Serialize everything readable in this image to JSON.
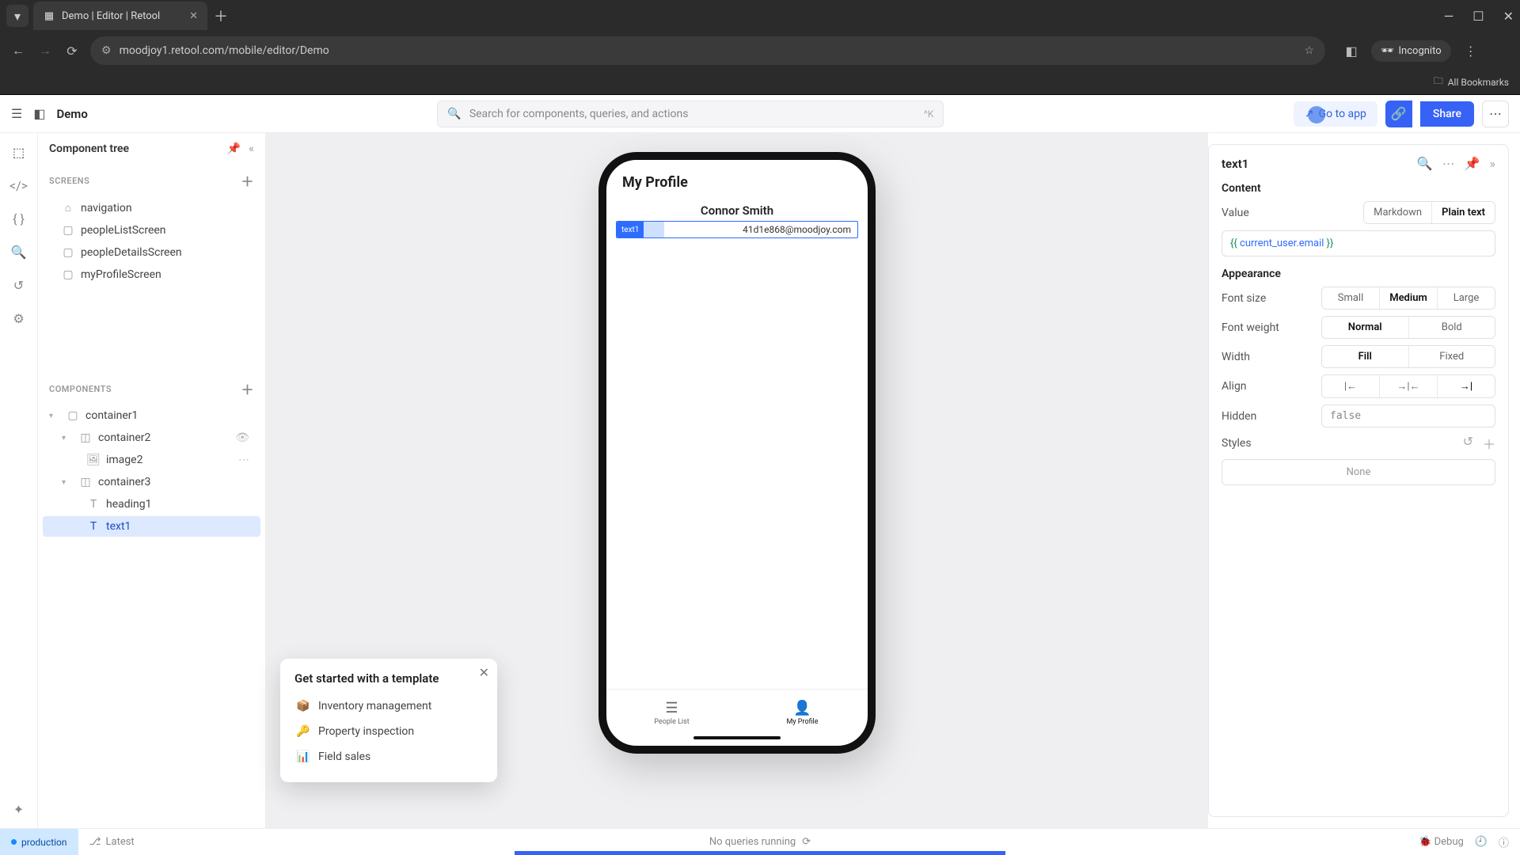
{
  "browser": {
    "tab_title": "Demo | Editor | Retool",
    "url": "moodjoy1.retool.com/mobile/editor/Demo",
    "incognito": "Incognito",
    "bookmarks": "All Bookmarks"
  },
  "header": {
    "app_name": "Demo",
    "search_placeholder": "Search for components, queries, and actions",
    "search_kbd": "^K",
    "go_to_app": "Go to app",
    "share": "Share"
  },
  "sidebar": {
    "title": "Component tree",
    "screens_label": "SCREENS",
    "screens": [
      {
        "label": "navigation",
        "icon": "home"
      },
      {
        "label": "peopleListScreen",
        "icon": "screen"
      },
      {
        "label": "peopleDetailsScreen",
        "icon": "screen"
      },
      {
        "label": "myProfileScreen",
        "icon": "screen"
      }
    ],
    "components_label": "COMPONENTS",
    "components": [
      {
        "label": "container1",
        "depth": 0,
        "icon": "box",
        "caret": true,
        "hidden": false
      },
      {
        "label": "container2",
        "depth": 1,
        "icon": "box-dash",
        "caret": true,
        "hidden": true
      },
      {
        "label": "image2",
        "depth": 2,
        "icon": "image",
        "caret": false,
        "hidden": false
      },
      {
        "label": "container3",
        "depth": 1,
        "icon": "box-dash",
        "caret": true,
        "hidden": false
      },
      {
        "label": "heading1",
        "depth": 2,
        "icon": "text",
        "caret": false,
        "hidden": false
      },
      {
        "label": "text1",
        "depth": 2,
        "icon": "text",
        "caret": false,
        "selected": true
      }
    ]
  },
  "popup": {
    "title": "Get started with a template",
    "options": [
      "Inventory management",
      "Property inspection",
      "Field sales"
    ]
  },
  "phone": {
    "screen_title": "My Profile",
    "name": "Connor Smith",
    "email_tag": "text1",
    "email": "41d1e868@moodjoy.com",
    "tabs": [
      {
        "label": "People List",
        "icon": "list",
        "active": false
      },
      {
        "label": "My Profile",
        "icon": "person",
        "active": true
      }
    ]
  },
  "inspector": {
    "title": "text1",
    "content_label": "Content",
    "value_label": "Value",
    "value_code_delim_l": "{{ ",
    "value_code": "current_user.email",
    "value_code_delim_r": " }}",
    "value_type_options": [
      "Markdown",
      "Plain text"
    ],
    "value_type_selected": "Plain text",
    "appearance_label": "Appearance",
    "fontsize_label": "Font size",
    "fontsize_options": [
      "Small",
      "Medium",
      "Large"
    ],
    "fontsize_selected": "Medium",
    "fontweight_label": "Font weight",
    "fontweight_options": [
      "Normal",
      "Bold"
    ],
    "fontweight_selected": "Normal",
    "width_label": "Width",
    "width_options": [
      "Fill",
      "Fixed"
    ],
    "width_selected": "Fill",
    "align_label": "Align",
    "hidden_label": "Hidden",
    "hidden_value": "false",
    "styles_label": "Styles",
    "styles_none": "None"
  },
  "footer": {
    "env": "production",
    "latest": "Latest",
    "center": "No queries running",
    "debug": "Debug"
  }
}
